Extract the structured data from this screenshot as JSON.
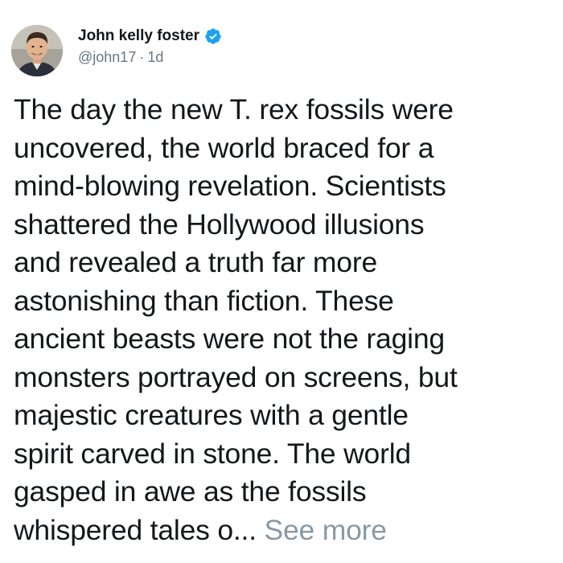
{
  "author": {
    "display_name": "John kelly foster",
    "handle": "@john17",
    "separator": "·",
    "timestamp": "1d",
    "verified": true,
    "avatar_icon": "user-avatar-photo",
    "verified_icon": "verified-badge-icon",
    "verified_color": "#1da1f2"
  },
  "tweet": {
    "lines": [
      "The day the new T. rex fossils were",
      "uncovered, the world braced for a",
      "mind-blowing revelation. Scientists",
      "shattered the Hollywood illusions",
      "and revealed a truth far more",
      "astonishing than fiction. These",
      "ancient beasts were not the raging",
      "monsters portrayed on screens, but",
      "majestic creatures with a gentle",
      "spirit carved in stone. The world",
      "gasped in awe as the fossils",
      "whispered tales o..."
    ],
    "see_more_label": "See more"
  },
  "colors": {
    "text_primary": "#14171a",
    "text_secondary": "#657786",
    "see_more": "#8899a6"
  }
}
